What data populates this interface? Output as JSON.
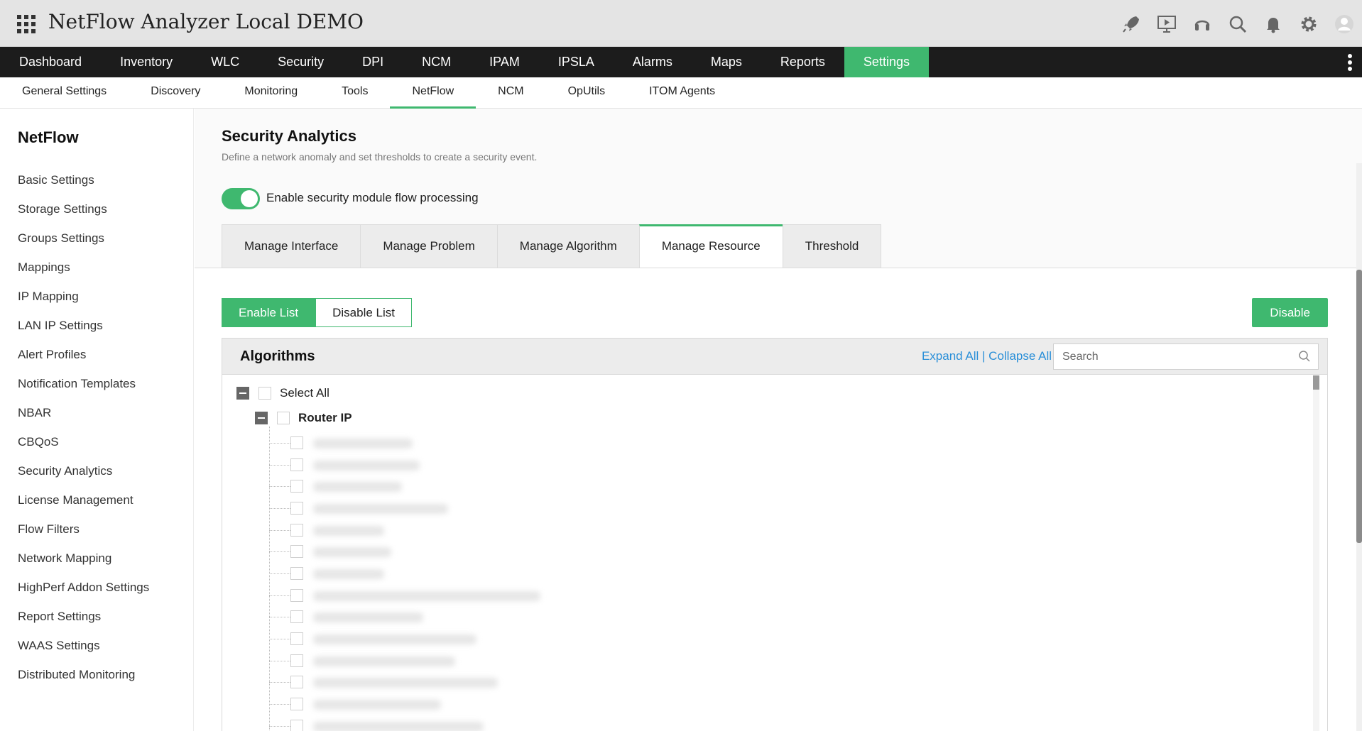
{
  "app": {
    "title": "NetFlow Analyzer Local DEMO"
  },
  "header_icons": [
    "rocket-icon",
    "presentation-icon",
    "headset-icon",
    "search-icon",
    "bell-icon",
    "gear-icon",
    "user-avatar-icon"
  ],
  "main_nav": [
    "Dashboard",
    "Inventory",
    "WLC",
    "Security",
    "DPI",
    "NCM",
    "IPAM",
    "IPSLA",
    "Alarms",
    "Maps",
    "Reports",
    "Settings"
  ],
  "main_nav_active": "Settings",
  "sub_nav": [
    "General Settings",
    "Discovery",
    "Monitoring",
    "Tools",
    "NetFlow",
    "NCM",
    "OpUtils",
    "ITOM Agents"
  ],
  "sub_nav_active": "NetFlow",
  "sidebar": {
    "title": "NetFlow",
    "items": [
      "Basic Settings",
      "Storage Settings",
      "Groups Settings",
      "Mappings",
      "IP Mapping",
      "LAN IP Settings",
      "Alert Profiles",
      "Notification Templates",
      "NBAR",
      "CBQoS",
      "Security Analytics",
      "License Management",
      "Flow Filters",
      "Network Mapping",
      "HighPerf Addon Settings",
      "Report Settings",
      "WAAS Settings",
      "Distributed Monitoring"
    ]
  },
  "page": {
    "title": "Security Analytics",
    "description": "Define a network anomaly and set thresholds to create a security event.",
    "toggle_label": "Enable security module flow processing",
    "toggle_on": true
  },
  "tabs": [
    "Manage Interface",
    "Manage Problem",
    "Manage Algorithm",
    "Manage Resource",
    "Threshold"
  ],
  "tabs_active": "Manage Resource",
  "list_buttons": {
    "enable": "Enable List",
    "disable": "Disable List"
  },
  "disable_button": "Disable",
  "algorithms": {
    "title": "Algorithms",
    "expand_all": "Expand All",
    "separator": " | ",
    "collapse_all": "Collapse All",
    "search_placeholder": "Search",
    "select_all": "Select All",
    "group": "Router IP"
  },
  "colors": {
    "accent": "#3fb86f",
    "link": "#2a8fd8",
    "nav_bg": "#1c1c1c",
    "header_bg": "#e4e4e4"
  }
}
